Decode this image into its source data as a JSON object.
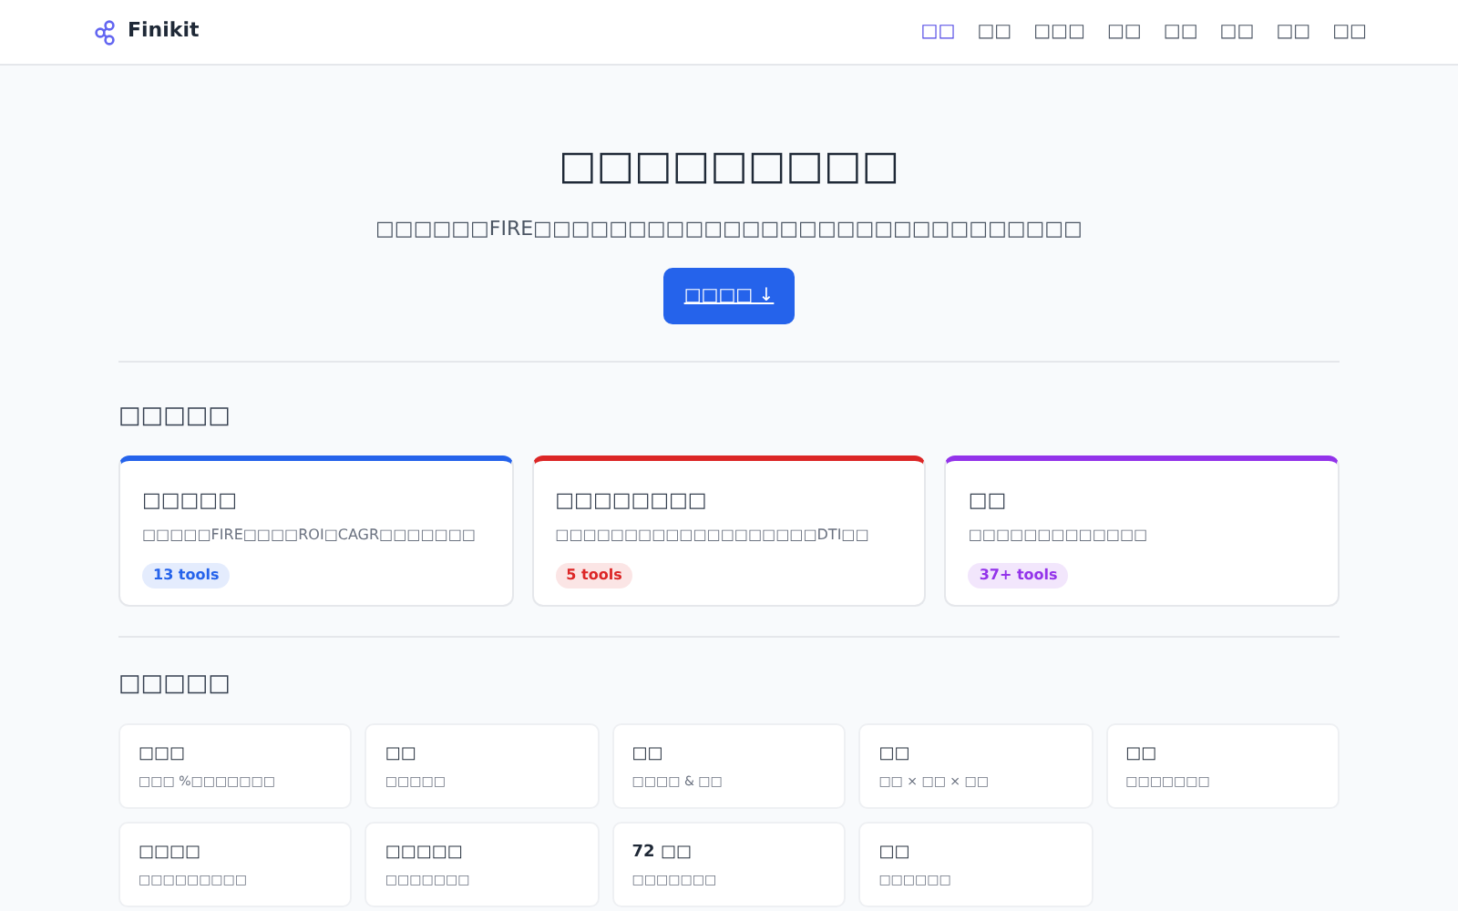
{
  "header": {
    "brand": "Finikit",
    "nav": [
      {
        "label": "□□",
        "selected": true
      },
      {
        "label": "□□",
        "selected": false
      },
      {
        "label": "□□□",
        "selected": false
      },
      {
        "label": "□□",
        "selected": false
      },
      {
        "label": "□□",
        "selected": false
      },
      {
        "label": "□□",
        "selected": false
      },
      {
        "label": "□□",
        "selected": false
      },
      {
        "label": "□□",
        "selected": false
      }
    ]
  },
  "hero": {
    "title": "□□□□□□□□□",
    "subtitle": "□□□□□□FIRE□□□□□□□□□□□□□□□□□□□□□□□□□□□□□",
    "button": "□□□□ ↓"
  },
  "categories": {
    "title": "□□□□□",
    "items": [
      {
        "title": "□□□□□",
        "description": "□□□□□FIRE□□□□ROI□CAGR□□□□□□□",
        "badge": "13 tools",
        "color": "#2563eb"
      },
      {
        "title": "□□□□□□□□",
        "description": "□□□□□□□□□□□□□□□□□□□DTI□□",
        "badge": "5 tools",
        "color": "#dc2626"
      },
      {
        "title": "□□",
        "description": "□□□□□□□□□□□□□",
        "badge": "37+ tools",
        "color": "#9333ea"
      }
    ]
  },
  "tools": {
    "title": "□□□□□",
    "items": [
      {
        "title": "□□□",
        "description": "□□□ %□□□□□□□"
      },
      {
        "title": "□□",
        "description": "□□□□□"
      },
      {
        "title": "□□",
        "description": "□□□□ & □□"
      },
      {
        "title": "□□",
        "description": "□□ × □□ × □□"
      },
      {
        "title": "□□",
        "description": "□□□□□□□"
      },
      {
        "title": "□□□□",
        "description": "□□□□□□□□□"
      },
      {
        "title": "□□□□□",
        "description": "□□□□□□□"
      },
      {
        "title": "72 □□",
        "description": "□□□□□□□"
      },
      {
        "title": "□□",
        "description": "□□□□□□"
      }
    ]
  }
}
